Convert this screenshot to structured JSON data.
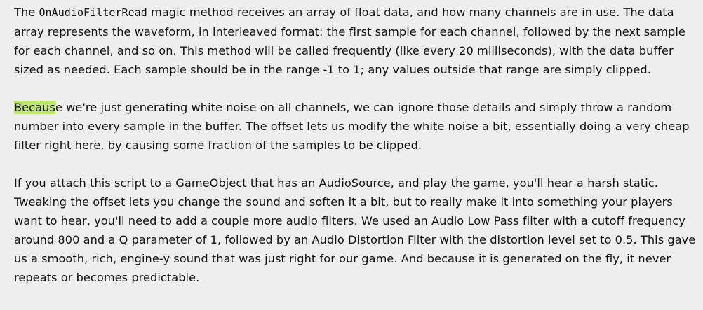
{
  "article": {
    "p1": {
      "intro": "The ",
      "code": "OnAudioFilterRead",
      "rest": " magic method receives an array of float data, and how many channels are in use.  The data array represents the waveform, in interleaved format: the first sample for each channel, followed by the next sample for each channel, and so on.  This method will be called frequently (like every 20 milliseconds), with the data buffer sized as needed.  Each sample should be in the range -1 to 1; any values outside that range are simply clipped."
    },
    "p2": {
      "highlighted": "Becaus",
      "rest": "e we're just generating white noise on all channels, we can ignore those details and simply throw a random number into every sample in the buffer.  The offset lets us modify the white noise a bit, essentially doing a very cheap filter right here, by causing some fraction of the samples to be clipped."
    },
    "p3": {
      "text": "If you attach this script to a GameObject that has an AudioSource, and play the game, you'll hear a harsh static.  Tweaking the offset lets you change the sound and soften it a bit, but to really make it into something your players want to hear, you'll need to add a couple more audio filters.  We used an Audio Low Pass filter with a cutoff frequency around 800 and a Q parameter of 1, followed by an Audio Distortion Filter with the distortion level set to 0.5.  This gave us a smooth, rich, engine-y sound that was just right for our game.  And because it is generated on the fly, it never repeats or becomes predictable."
    }
  }
}
